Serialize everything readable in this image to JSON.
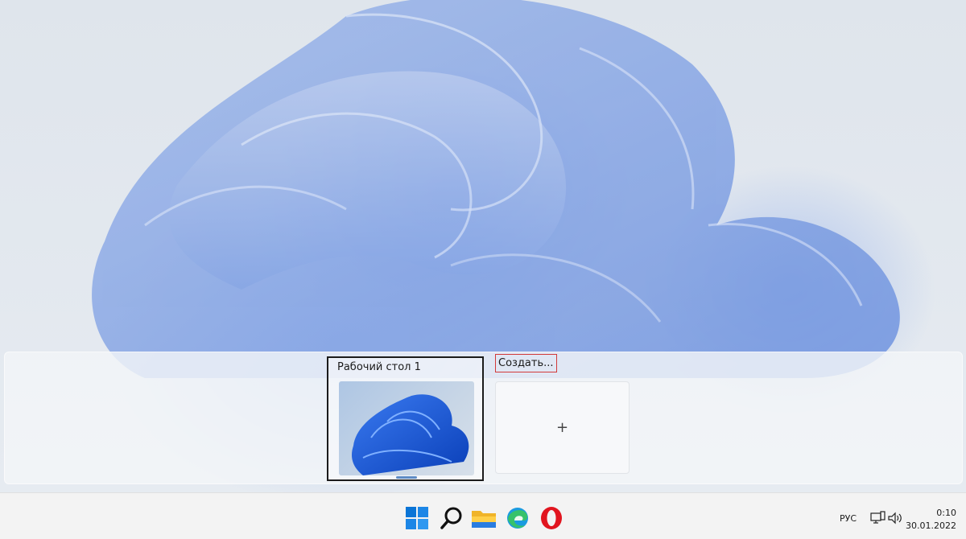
{
  "task_view": {
    "desktops": [
      {
        "title": "Рабочий стол 1"
      }
    ],
    "new_desktop_label": "Создать...",
    "new_desktop_icon": "plus-icon",
    "plus_glyph": "+"
  },
  "taskbar": {
    "icons": [
      "windows-start-icon",
      "search-icon",
      "file-explorer-icon",
      "edge-icon",
      "opera-icon"
    ],
    "language": "РУС",
    "tray_icons": [
      "network-icon",
      "volume-icon"
    ],
    "time": "0:10",
    "date": "30.01.2022"
  },
  "colors": {
    "accent": "#0078d4",
    "selection_border": "#1b1b1b",
    "highlight_box": "#d23a3a"
  }
}
